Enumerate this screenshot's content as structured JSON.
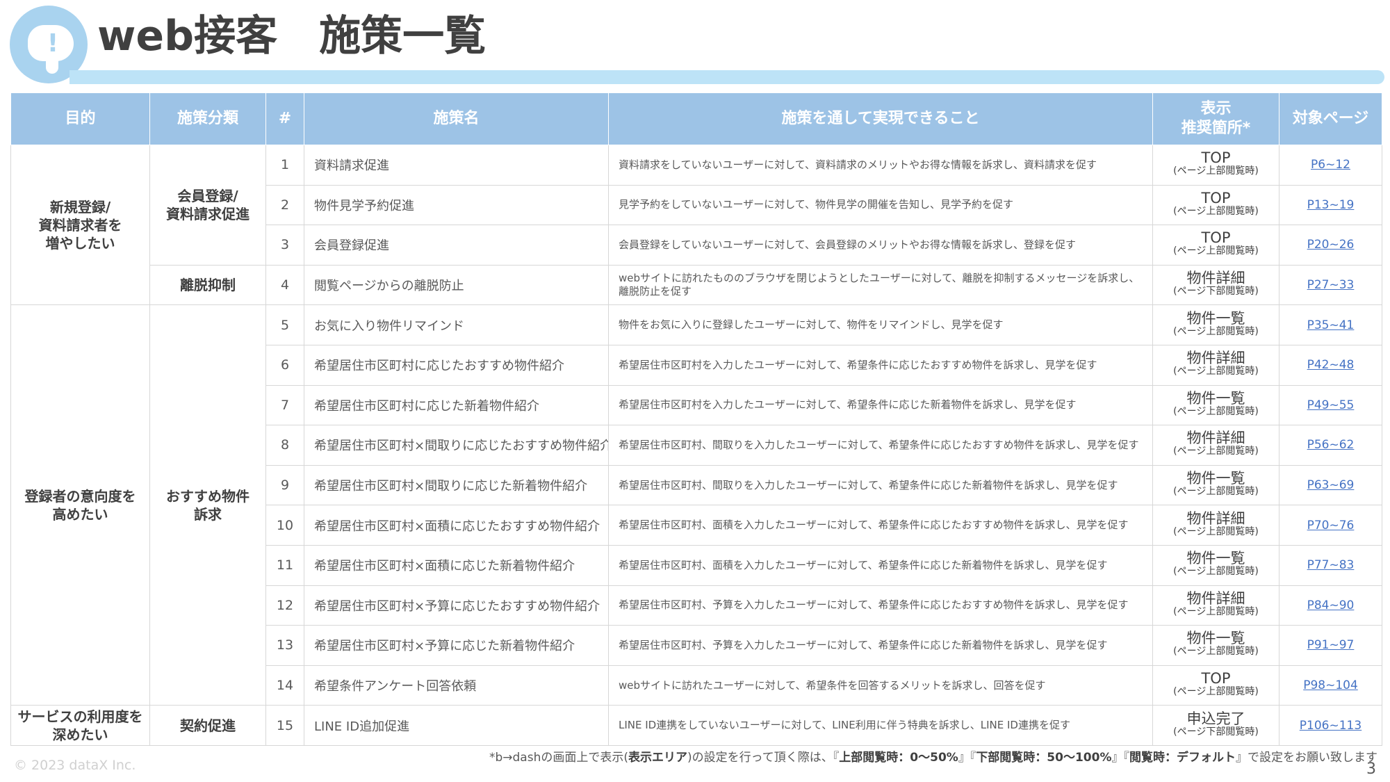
{
  "header": {
    "title": "web接客　施策一覧",
    "logo_icon": "cloud-exclamation-icon",
    "logo_mark": "!"
  },
  "colors": {
    "header_bg": "#9dc3e6",
    "title_bar": "#bde3f7",
    "logo": "#a9d3ef",
    "link": "#4472c4"
  },
  "table": {
    "headers": [
      "目的",
      "施策分類",
      "#",
      "施策名",
      "施策を通して実現できること",
      "表示\n推奨箇所*",
      "対象ページ"
    ],
    "purposes": [
      {
        "label": "新規登録/\n資料請求者を\n増やしたい"
      },
      {
        "label": "登録者の意向度を\n高めたい"
      },
      {
        "label": "サービスの利用度を\n深めたい"
      }
    ],
    "categories": [
      {
        "label": "会員登録/\n資料請求促進"
      },
      {
        "label": "離脱抑制"
      },
      {
        "label": "おすすめ物件\n訴求"
      },
      {
        "label": "契約促進"
      }
    ],
    "rows": [
      {
        "num": "1",
        "name": "資料請求促進",
        "desc": "資料請求をしていないユーザーに対して、資料請求のメリットやお得な情報を訴求し、資料請求を促す",
        "area_main": "TOP",
        "area_sub": "(ページ上部閲覧時)",
        "pages": "P6~12"
      },
      {
        "num": "2",
        "name": "物件見学予約促進",
        "desc": "見学予約をしていないユーザーに対して、物件見学の開催を告知し、見学予約を促す",
        "area_main": "TOP",
        "area_sub": "(ページ上部閲覧時)",
        "pages": "P13~19"
      },
      {
        "num": "3",
        "name": "会員登録促進",
        "desc": "会員登録をしていないユーザーに対して、会員登録のメリットやお得な情報を訴求し、登録を促す",
        "area_main": "TOP",
        "area_sub": "(ページ上部閲覧時)",
        "pages": "P20~26"
      },
      {
        "num": "4",
        "name": "閲覧ページからの離脱防止",
        "desc": "webサイトに訪れたもののブラウザを閉じようとしたユーザーに対して、離脱を抑制するメッセージを訴求し、\n離脱防止を促す",
        "area_main": "物件詳細",
        "area_sub": "(ページ下部閲覧時)",
        "pages": "P27~33"
      },
      {
        "num": "5",
        "name": "お気に入り物件リマインド",
        "desc": "物件をお気に入りに登録したユーザーに対して、物件をリマインドし、見学を促す",
        "area_main": "物件一覧",
        "area_sub": "(ページ上部閲覧時)",
        "pages": "P35~41"
      },
      {
        "num": "6",
        "name": "希望居住市区町村に応じたおすすめ物件紹介",
        "desc": "希望居住市区町村を入力したユーザーに対して、希望条件に応じたおすすめ物件を訴求し、見学を促す",
        "area_main": "物件詳細",
        "area_sub": "(ページ上部閲覧時)",
        "pages": "P42~48"
      },
      {
        "num": "7",
        "name": "希望居住市区町村に応じた新着物件紹介",
        "desc": "希望居住市区町村を入力したユーザーに対して、希望条件に応じた新着物件を訴求し、見学を促す",
        "area_main": "物件一覧",
        "area_sub": "(ページ上部閲覧時)",
        "pages": "P49~55"
      },
      {
        "num": "8",
        "name": "希望居住市区町村×間取りに応じたおすすめ物件紹介",
        "desc": "希望居住市区町村、間取りを入力したユーザーに対して、希望条件に応じたおすすめ物件を訴求し、見学を促す",
        "area_main": "物件詳細",
        "area_sub": "(ページ上部閲覧時)",
        "pages": "P56~62"
      },
      {
        "num": "9",
        "name": "希望居住市区町村×間取りに応じた新着物件紹介",
        "desc": "希望居住市区町村、間取りを入力したユーザーに対して、希望条件に応じた新着物件を訴求し、見学を促す",
        "area_main": "物件一覧",
        "area_sub": "(ページ上部閲覧時)",
        "pages": "P63~69"
      },
      {
        "num": "10",
        "name": "希望居住市区町村×面積に応じたおすすめ物件紹介",
        "desc": "希望居住市区町村、面積を入力したユーザーに対して、希望条件に応じたおすすめ物件を訴求し、見学を促す",
        "area_main": "物件詳細",
        "area_sub": "(ページ上部閲覧時)",
        "pages": "P70~76"
      },
      {
        "num": "11",
        "name": "希望居住市区町村×面積に応じた新着物件紹介",
        "desc": "希望居住市区町村、面積を入力したユーザーに対して、希望条件に応じた新着物件を訴求し、見学を促す",
        "area_main": "物件一覧",
        "area_sub": "(ページ上部閲覧時)",
        "pages": "P77~83"
      },
      {
        "num": "12",
        "name": "希望居住市区町村×予算に応じたおすすめ物件紹介",
        "desc": "希望居住市区町村、予算を入力したユーザーに対して、希望条件に応じたおすすめ物件を訴求し、見学を促す",
        "area_main": "物件詳細",
        "area_sub": "(ページ上部閲覧時)",
        "pages": "P84~90"
      },
      {
        "num": "13",
        "name": "希望居住市区町村×予算に応じた新着物件紹介",
        "desc": "希望居住市区町村、予算を入力したユーザーに対して、希望条件に応じた新着物件を訴求し、見学を促す",
        "area_main": "物件一覧",
        "area_sub": "(ページ上部閲覧時)",
        "pages": "P91~97"
      },
      {
        "num": "14",
        "name": "希望条件アンケート回答依頼",
        "desc": "webサイトに訪れたユーザーに対して、希望条件を回答するメリットを訴求し、回答を促す",
        "area_main": "TOP",
        "area_sub": "(ページ上部閲覧時)",
        "pages": "P98~104"
      },
      {
        "num": "15",
        "name": "LINE ID追加促進",
        "desc": "LINE ID連携をしていないユーザーに対して、LINE利用に伴う特典を訴求し、LINE ID連携を促す",
        "area_main": "申込完了",
        "area_sub": "(ページ下部閲覧時)",
        "pages": "P106~113"
      }
    ]
  },
  "footnote": {
    "part1": "*b→dashの画面上で表示(",
    "bold1": "表示エリア",
    "part2": ")の設定を行って頂く際は、『",
    "bold2": "上部閲覧時：0～50%",
    "part3": "』『",
    "bold3": "下部閲覧時：50～100%",
    "part4": "』『",
    "bold4": "閲覧時：デフォルト",
    "part5": "』で設定をお願い致します"
  },
  "footer": {
    "copyright": "© 2023 dataX Inc.",
    "page_number": "3"
  }
}
